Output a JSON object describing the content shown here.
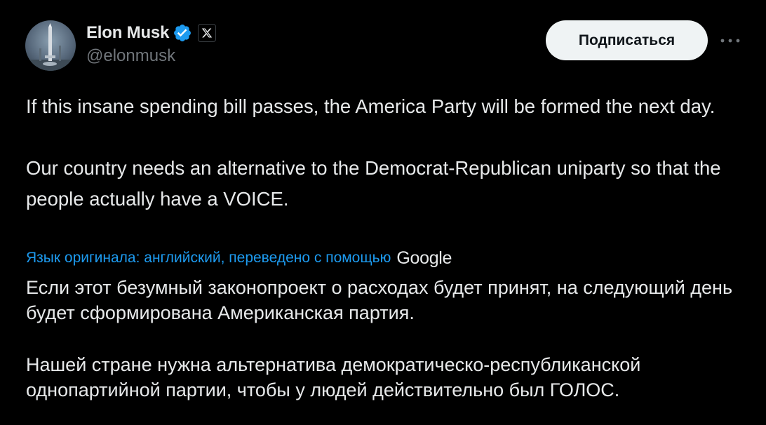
{
  "author": {
    "display_name": "Elon Musk",
    "handle": "@elonmusk",
    "avatar_icon": "rocket-launch-avatar",
    "verified_icon": "verified-badge-icon",
    "affiliation_icon": "x-logo-icon"
  },
  "actions": {
    "subscribe_label": "Подписаться",
    "more_icon": "more-horizontal-icon"
  },
  "tweet": {
    "paragraph_1": "If this insane spending bill passes, the America Party will be formed the next day.",
    "paragraph_2": "Our country needs an alternative to the Democrat-Republican uniparty so that the people actually have a VOICE."
  },
  "translation": {
    "note": "Язык оригинала: английский, переведено с помощью",
    "provider": "Google",
    "paragraph_1": "Если этот безумный законопроект о расходах будет принят, на следующий день будет сформирована Американская партия.",
    "paragraph_2": "Нашей стране нужна альтернатива демократическо-республиканской однопартийной партии, чтобы у людей действительно был ГОЛОС."
  },
  "colors": {
    "background": "#000000",
    "text_primary": "#e7e9ea",
    "text_secondary": "#71767b",
    "accent_blue": "#1d9bf0",
    "button_bg": "#eff3f4"
  }
}
